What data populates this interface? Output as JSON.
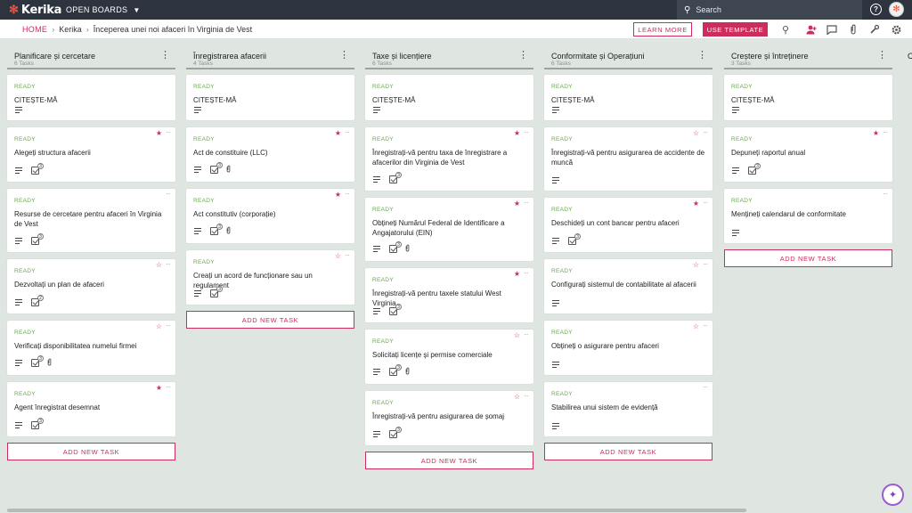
{
  "app": {
    "logo": "Kerika",
    "boards_menu": "OPEN BOARDS",
    "search_placeholder": "Search"
  },
  "breadcrumb": {
    "home": "HOME",
    "org": "Kerika",
    "board": "Începerea unei noi afaceri în Virginia de Vest"
  },
  "actions": {
    "learn_more": "LEARN MORE",
    "use_template": "USE TEMPLATE"
  },
  "icons": {
    "search": "search-icon",
    "add_person": "add-person-icon",
    "chat": "chat-icon",
    "attachment": "attachment-icon",
    "tools": "wrench-icon",
    "settings": "gear-icon",
    "help": "help-icon"
  },
  "colors": {
    "accent": "#cc2d5c",
    "ready": "#6aa84f",
    "topbar": "#2d3440",
    "board_bg": "#dfe6e2"
  },
  "add_task_label": "ADD NEW TASK",
  "columns": [
    {
      "title": "Planificare și cercetare",
      "count": "6 Tasks",
      "cards": [
        {
          "status": "READY",
          "title": "CITEȘTE-MĂ",
          "star": "none",
          "chk": null,
          "clip": false
        },
        {
          "status": "READY",
          "title": "Alegeți structura afacerii",
          "star": "filled",
          "chk": "3",
          "clip": false
        },
        {
          "status": "READY",
          "title": "Resurse de cercetare pentru afaceri în Virginia de Vest",
          "star": "none",
          "chk": "3",
          "clip": false
        },
        {
          "status": "READY",
          "title": "Dezvoltați un plan de afaceri",
          "star": "outline",
          "chk": "2",
          "clip": false
        },
        {
          "status": "READY",
          "title": "Verificați disponibilitatea numelui firmei",
          "star": "outline",
          "chk": "3",
          "clip": true
        },
        {
          "status": "READY",
          "title": "Agent înregistrat desemnat",
          "star": "filled",
          "chk": "3",
          "clip": false
        }
      ]
    },
    {
      "title": "Înregistrarea afacerii",
      "count": "4 Tasks",
      "cards": [
        {
          "status": "READY",
          "title": "CITEȘTE-MĂ",
          "star": "none",
          "chk": null,
          "clip": false
        },
        {
          "status": "READY",
          "title": "Act de constituire (LLC)",
          "star": "filled",
          "chk": "3",
          "clip": true
        },
        {
          "status": "READY",
          "title": "Act constitutiv (corporație)",
          "star": "filled",
          "chk": "3",
          "clip": true
        },
        {
          "status": "READY",
          "title": "Creați un acord de funcționare sau un regulament",
          "star": "outline",
          "chk": "3",
          "clip": false
        }
      ]
    },
    {
      "title": "Taxe și licențiere",
      "count": "6 Tasks",
      "cards": [
        {
          "status": "READY",
          "title": "CITEȘTE-MĂ",
          "star": "none",
          "chk": null,
          "clip": false
        },
        {
          "status": "READY",
          "title": "Înregistrați-vă pentru taxa de înregistrare a afacerilor din Virginia de Vest",
          "star": "filled",
          "chk": "3",
          "clip": false
        },
        {
          "status": "READY",
          "title": "Obțineți Numărul Federal de Identificare a Angajatorului (EIN)",
          "star": "filled",
          "chk": "3",
          "clip": true
        },
        {
          "status": "READY",
          "title": "Înregistrați-vă pentru taxele statului West Virginia",
          "star": "filled",
          "chk": "3",
          "clip": false
        },
        {
          "status": "READY",
          "title": "Solicitați licențe și permise comerciale",
          "star": "outline",
          "chk": "3",
          "clip": true
        },
        {
          "status": "READY",
          "title": "Înregistrați-vă pentru asigurarea de șomaj",
          "star": "outline",
          "chk": "3",
          "clip": false
        }
      ]
    },
    {
      "title": "Conformitate și Operațiuni",
      "count": "6 Tasks",
      "cards": [
        {
          "status": "READY",
          "title": "CITEȘTE-MĂ",
          "star": "none",
          "chk": null,
          "clip": false
        },
        {
          "status": "READY",
          "title": "Înregistrați-vă pentru asigurarea de accidente de muncă",
          "star": "outline",
          "chk": null,
          "clip": false
        },
        {
          "status": "READY",
          "title": "Deschideți un cont bancar pentru afaceri",
          "star": "filled",
          "chk": "3",
          "clip": false
        },
        {
          "status": "READY",
          "title": "Configurați sistemul de contabilitate al afacerii",
          "star": "outline",
          "chk": null,
          "clip": false
        },
        {
          "status": "READY",
          "title": "Obțineți o asigurare pentru afaceri",
          "star": "outline",
          "chk": null,
          "clip": false
        },
        {
          "status": "READY",
          "title": "Stabilirea unui sistem de evidență",
          "star": "none",
          "chk": null,
          "clip": false
        }
      ]
    },
    {
      "title": "Creștere și întreținere",
      "count": "3 Tasks",
      "cards": [
        {
          "status": "READY",
          "title": "CITEȘTE-MĂ",
          "star": "none",
          "chk": null,
          "clip": false
        },
        {
          "status": "READY",
          "title": "Depuneți raportul anual",
          "star": "filled",
          "chk": "3",
          "clip": false
        },
        {
          "status": "READY",
          "title": "Mențineți calendarul de conformitate",
          "star": "none",
          "chk": null,
          "clip": false
        }
      ]
    }
  ]
}
